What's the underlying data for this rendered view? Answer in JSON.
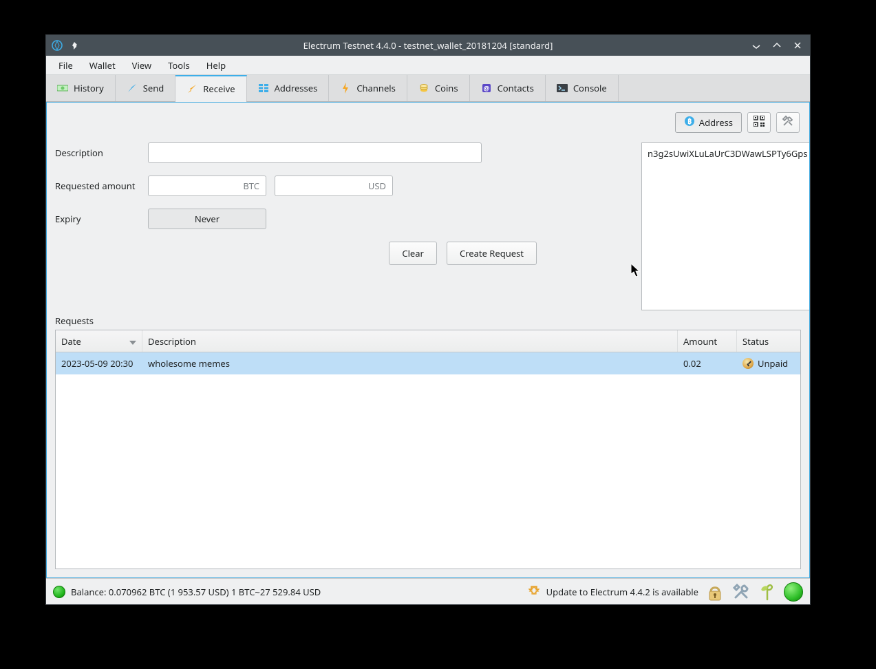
{
  "titlebar": {
    "title": "Electrum Testnet 4.4.0 - testnet_wallet_20181204 [standard]"
  },
  "menu": {
    "file": "File",
    "wallet": "Wallet",
    "view": "View",
    "tools": "Tools",
    "help": "Help"
  },
  "tabs": {
    "history": "History",
    "send": "Send",
    "receive": "Receive",
    "addresses": "Addresses",
    "channels": "Channels",
    "coins": "Coins",
    "contacts": "Contacts",
    "console": "Console"
  },
  "receive": {
    "address_button": "Address",
    "description_label": "Description",
    "requested_amount_label": "Requested amount",
    "btc_unit": "BTC",
    "usd_unit": "USD",
    "expiry_label": "Expiry",
    "expiry_value": "Never",
    "clear_button": "Clear",
    "create_button": "Create Request",
    "address_value": "n3g2sUwiXLuLaUrC3DWawLSPTy6Gps"
  },
  "requests": {
    "section_label": "Requests",
    "headers": {
      "date": "Date",
      "description": "Description",
      "amount": "Amount",
      "status": "Status"
    },
    "rows": [
      {
        "date": "2023-05-09 20:30",
        "description": "wholesome memes",
        "amount": "0.02",
        "status": "Unpaid"
      }
    ]
  },
  "statusbar": {
    "balance": "Balance: 0.070962 BTC (1 953.57 USD)  1 BTC~27 529.84 USD",
    "update": "Update to Electrum 4.4.2 is available"
  }
}
